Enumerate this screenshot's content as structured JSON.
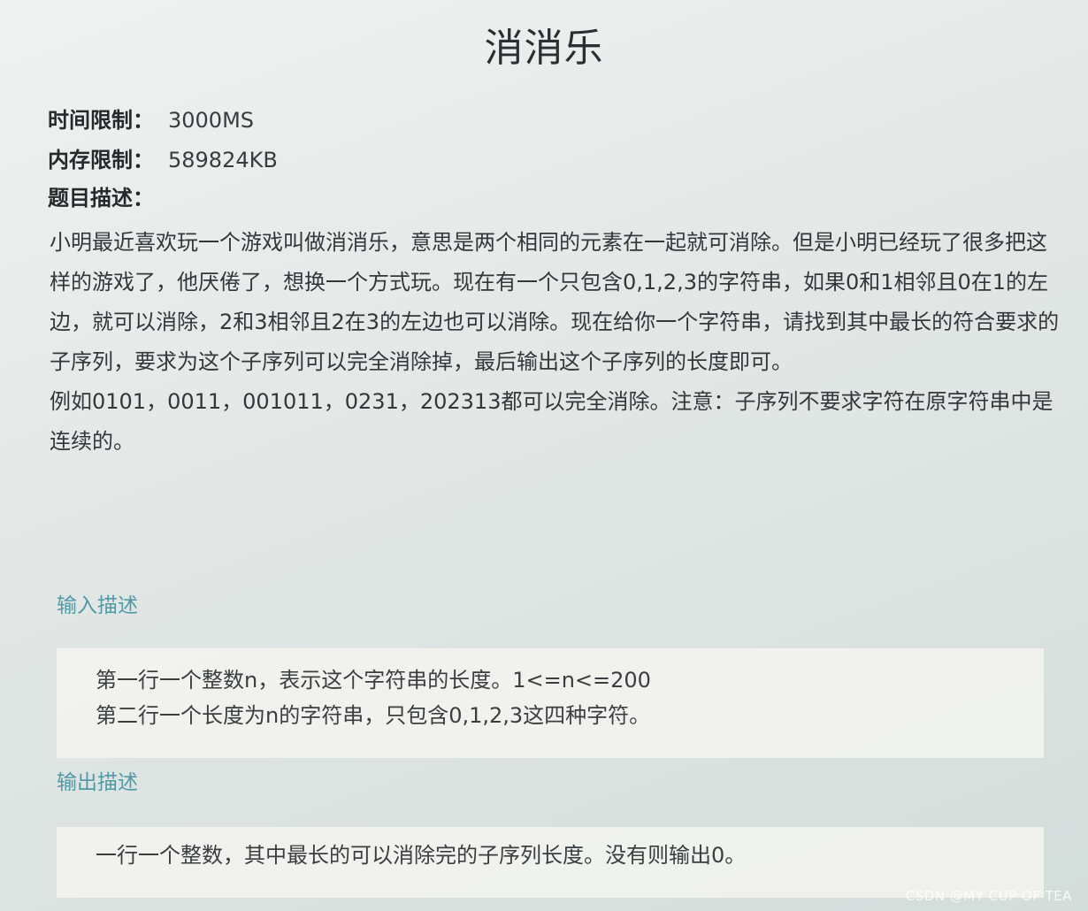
{
  "problem": {
    "title": "消消乐",
    "time_limit_label": "时间限制：",
    "time_limit_value": "3000MS",
    "memory_limit_label": "内存限制：",
    "memory_limit_value": "589824KB",
    "description_heading": "题目描述：",
    "description_paragraphs": [
      "小明最近喜欢玩一个游戏叫做消消乐，意思是两个相同的元素在一起就可消除。但是小明已经玩了很多把这样的游戏了，他厌倦了，想换一个方式玩。现在有一个只包含0,1,2,3的字符串，如果0和1相邻且0在1的左边，就可以消除，2和3相邻且2在3的左边也可以消除。现在给你一个字符串，请找到其中最长的符合要求的子序列，要求为这个子序列可以完全消除掉，最后输出这个子序列的长度即可。",
      "例如0101，0011，001011，0231，202313都可以完全消除。注意：子序列不要求字符在原字符串中是连续的。"
    ]
  },
  "input_section": {
    "heading": "输入描述",
    "lines": [
      "第一行一个整数n，表示这个字符串的长度。1<=n<=200",
      "第二行一个长度为n的字符串，只包含0,1,2,3这四种字符。"
    ]
  },
  "output_section": {
    "heading": "输出描述",
    "lines": [
      "一行一个整数，其中最长的可以消除完的子序列长度。没有则输出0。"
    ]
  },
  "watermark": "CSDN @MY CUP OF TEA"
}
